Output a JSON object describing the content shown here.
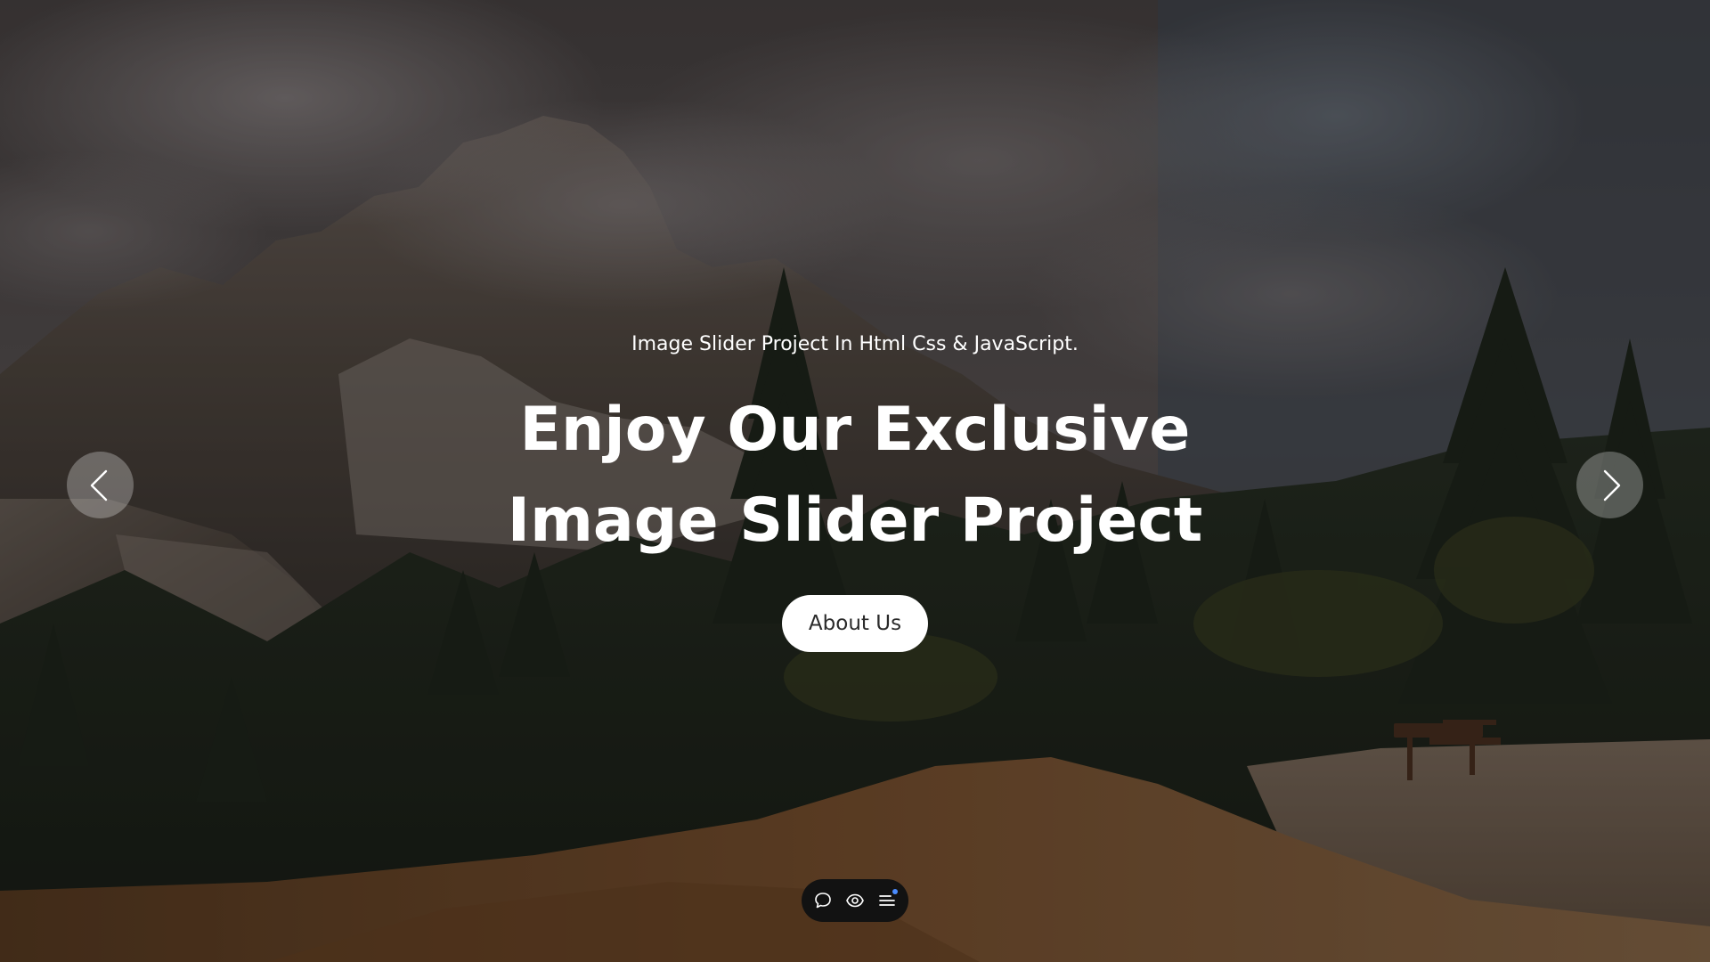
{
  "slider": {
    "subtitle": "Image Slider Project In Html Css & JavaScript.",
    "headline_line1": "Enjoy Our Exclusive",
    "headline_line2": "Image Slider Project",
    "cta_label": "About Us",
    "prev_icon": "chevron-left-icon",
    "next_icon": "chevron-right-icon",
    "background": "mountain-forest-landscape-photo"
  },
  "toolbar": {
    "icons": [
      "comment-icon",
      "eye-icon",
      "menu-icon"
    ],
    "notification_color": "#4a8cff"
  },
  "colors": {
    "text": "#ffffff",
    "button_bg": "#ffffff",
    "button_text": "#2a2a2a",
    "toolbar_bg": "#121212"
  }
}
